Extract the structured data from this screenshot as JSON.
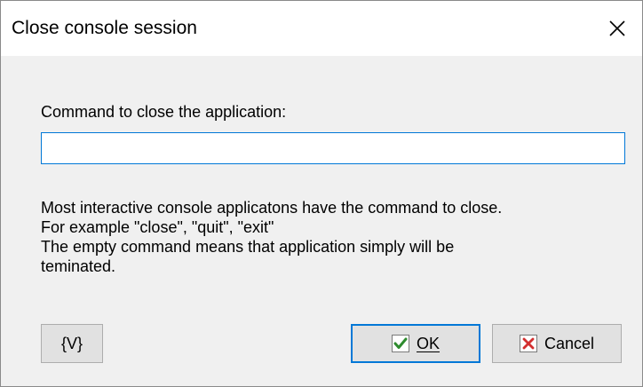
{
  "window": {
    "title": "Close console session"
  },
  "form": {
    "label": "Command to close the application:",
    "input_value": ""
  },
  "info": {
    "lines": [
      "Most interactive console applicatons have the command to close.",
      "For example \"close\", \"quit\", \"exit\"",
      "The empty command means that application simply will  be",
      "teminated."
    ]
  },
  "buttons": {
    "variable_label": "{V}",
    "ok_label": "OK",
    "cancel_label": "Cancel"
  },
  "icons": {
    "close": "close-icon",
    "ok": "checkmark-icon",
    "cancel": "x-mark-icon"
  },
  "colors": {
    "accent": "#0078d7",
    "ok_icon": "#2e8b2e",
    "cancel_icon": "#d32f2f"
  }
}
